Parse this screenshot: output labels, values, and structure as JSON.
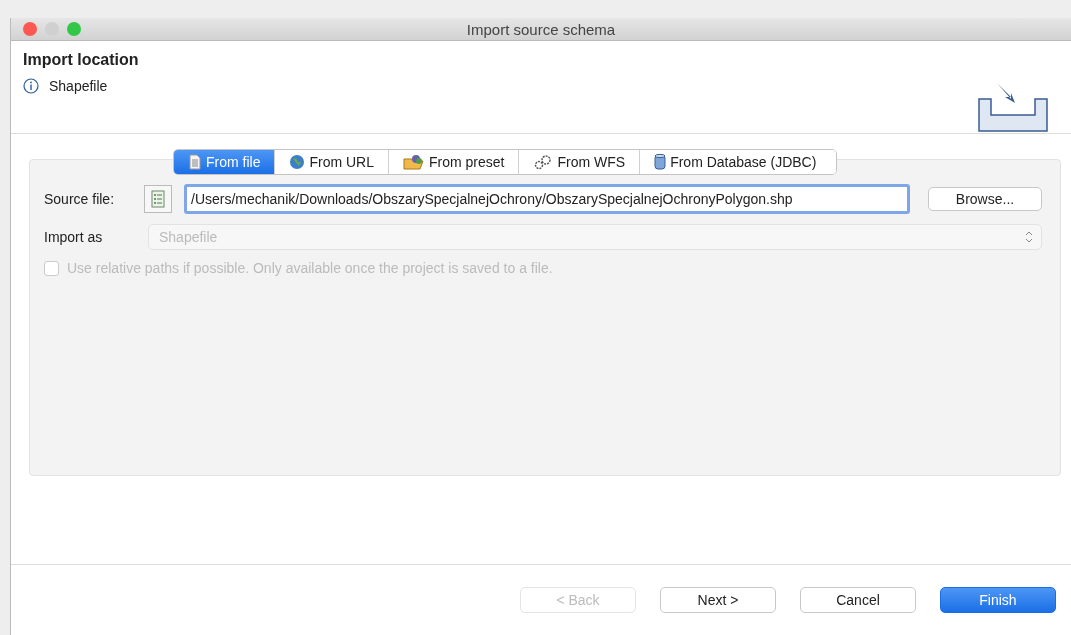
{
  "window": {
    "title": "Import source schema"
  },
  "header": {
    "title": "Import location",
    "info": "Shapefile"
  },
  "tabs": [
    {
      "label": "From file",
      "kind": "file",
      "selected": true
    },
    {
      "label": "From URL",
      "kind": "globe",
      "selected": false
    },
    {
      "label": "From preset",
      "kind": "folder",
      "selected": false
    },
    {
      "label": "From WFS",
      "kind": "gears",
      "selected": false
    },
    {
      "label": "From Database (JDBC)",
      "kind": "database",
      "selected": false
    }
  ],
  "source_file": {
    "label": "Source file:",
    "value": "/Users/mechanik/Downloads/ObszarySpecjalnejOchrony/ObszarySpecjalnejOchronyPolygon.shp",
    "browse": "Browse..."
  },
  "import_as": {
    "label": "Import as",
    "value": "Shapefile",
    "disabled": true
  },
  "relative_paths": {
    "label": "Use relative paths if possible. Only available once the project is saved to a file.",
    "checked": false,
    "disabled": true
  },
  "buttons": [
    {
      "label": "< Back",
      "disabled": true,
      "primary": false
    },
    {
      "label": "Next >",
      "disabled": false,
      "primary": false
    },
    {
      "label": "Cancel",
      "disabled": false,
      "primary": false
    },
    {
      "label": "Finish",
      "disabled": false,
      "primary": true
    }
  ]
}
